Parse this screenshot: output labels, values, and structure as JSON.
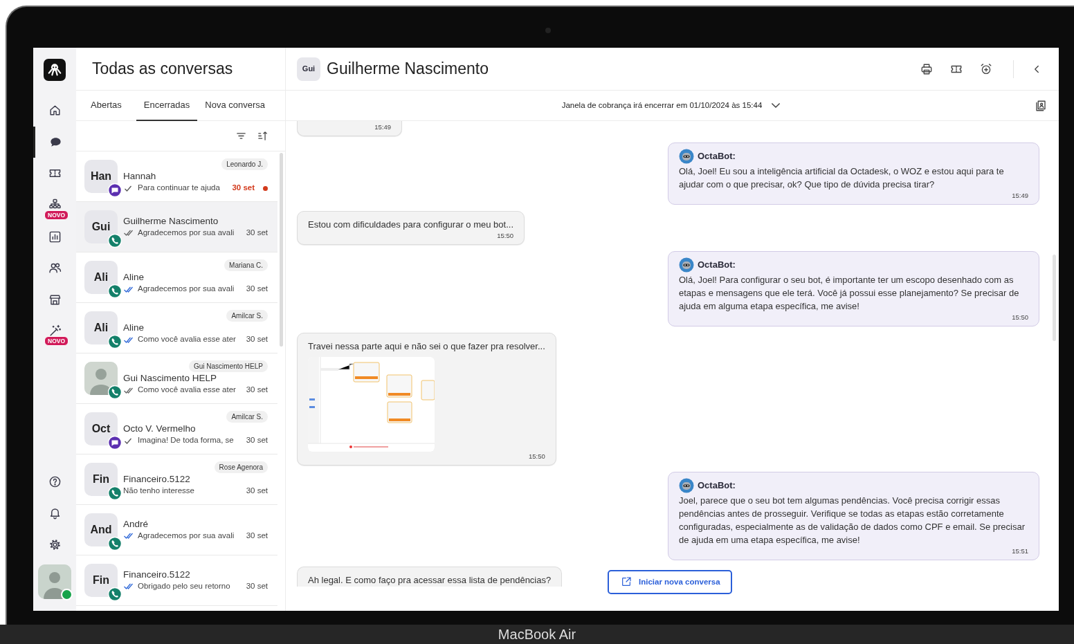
{
  "rail": {
    "items": [
      {
        "selected": false
      },
      {
        "selected": true
      },
      {
        "selected": false
      },
      {
        "selected": false,
        "badge": "NOVO"
      },
      {
        "selected": false
      },
      {
        "selected": false
      },
      {
        "selected": false
      },
      {
        "selected": false,
        "badge": "NOVO"
      }
    ],
    "bottom_items": [
      {
        "selected": false
      },
      {
        "selected": false
      },
      {
        "selected": false
      }
    ],
    "user_online": true
  },
  "list_panel": {
    "title": "Todas as conversas",
    "tabs": [
      {
        "label": "Abertas",
        "selected": false
      },
      {
        "label": "Encerradas",
        "selected": true
      },
      {
        "label": "Nova conversa",
        "selected": false
      }
    ]
  },
  "conversations": [
    {
      "initials": "Han",
      "chat_channel": true,
      "agent": "Leonardo J.",
      "name": "Hannah",
      "sent": true,
      "delivered": false,
      "read": false,
      "preview": "Para continuar te ajuda",
      "date": "30 set",
      "unread": true,
      "selected": false
    },
    {
      "initials": "Gui",
      "chat_channel": false,
      "name": "Guilherme Nascimento",
      "sent": true,
      "delivered": true,
      "read": false,
      "preview": "Agradecemos por sua avali",
      "date": "30 set",
      "unread": false,
      "selected": true
    },
    {
      "initials": "Ali",
      "chat_channel": false,
      "agent": "Mariana C.",
      "name": "Aline",
      "sent": true,
      "delivered": true,
      "read": true,
      "preview": "Agradecemos por sua avali",
      "date": "30 set",
      "unread": false,
      "selected": false
    },
    {
      "initials": "Ali",
      "chat_channel": false,
      "agent": "Amilcar S.",
      "name": "Aline",
      "sent": true,
      "delivered": true,
      "read": true,
      "preview": "Como você avalia esse ater",
      "date": "30 set",
      "unread": false,
      "selected": false
    },
    {
      "photo": true,
      "chat_channel": false,
      "agent": "Gui Nascimento HELP",
      "name": "Gui Nascimento HELP",
      "sent": true,
      "delivered": true,
      "read": false,
      "preview": "Como você avalia esse ater",
      "date": "30 set",
      "unread": false,
      "selected": false
    },
    {
      "initials": "Oct",
      "chat_channel": true,
      "agent": "Amilcar S.",
      "name": "Octo V. Vermelho",
      "sent": true,
      "delivered": false,
      "read": false,
      "preview": "Imagina! De toda forma, se",
      "date": "30 set",
      "unread": false,
      "selected": false
    },
    {
      "initials": "Fin",
      "chat_channel": false,
      "agent": "Rose Agenora",
      "name": "Financeiro.5122",
      "sent": false,
      "preview": "Não tenho interesse",
      "date": "30 set",
      "unread": false,
      "selected": false
    },
    {
      "initials": "And",
      "chat_channel": false,
      "name": "André",
      "sent": true,
      "delivered": true,
      "read": true,
      "preview": "Agradecemos por sua avali",
      "date": "30 set",
      "unread": false,
      "selected": false
    },
    {
      "initials": "Fin",
      "chat_channel": false,
      "name": "Financeiro.5122",
      "sent": true,
      "delivered": true,
      "read": true,
      "preview": "Obrigado pelo seu retorno",
      "date": "30 set",
      "unread": false,
      "selected": false
    }
  ],
  "chat": {
    "initials": "Gui",
    "name": "Guilherme Nascimento",
    "billing_notice": "Janela de cobrança irá encerrar em 01/10/2024 às 15:44",
    "messages": [
      {
        "kind": "incoming",
        "time": "15:49",
        "clipped": true
      },
      {
        "kind": "bot",
        "sender": "OctaBot:",
        "text": "Olá, Joel! Eu sou a inteligência artificial da Octadesk, o WOZ e estou aqui para te ajudar com o que precisar, ok? Que tipo de dúvida precisa tirar?",
        "time": "15:49"
      },
      {
        "kind": "incoming",
        "text": "Estou com dificuldades para configurar o meu bot...",
        "time": "15:50"
      },
      {
        "kind": "bot",
        "sender": "OctaBot:",
        "text": "Olá, Joel! Para configurar o seu bot, é importante ter um escopo desenhado com as etapas e mensagens que ele terá. Você já possui esse planejamento? Se precisar de ajuda em alguma etapa específica, me avise!",
        "time": "15:50"
      },
      {
        "kind": "incoming",
        "text": "Travei nessa parte aqui e não sei o que fazer pra resolver...",
        "image_attached": true,
        "time": "15:50"
      },
      {
        "kind": "bot",
        "sender": "OctaBot:",
        "text": "Joel, parece que o seu bot tem algumas pendências. Você precisa corrigir essas pendências antes de prosseguir. Verifique se todas as etapas estão corretamente configuradas, especialmente as de validação de dados como CPF e email. Se precisar de ajuda em uma etapa específica, me avise!",
        "time": "15:51"
      },
      {
        "kind": "incoming",
        "text": "Ah legal. E como faço pra acessar essa lista de pendências?",
        "clipped": true
      }
    ],
    "new_conversation_button": "Iniciar nova conversa"
  },
  "device_label": "MacBook Air"
}
